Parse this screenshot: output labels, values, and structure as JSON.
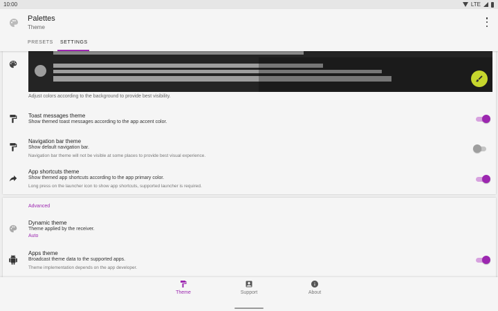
{
  "status_bar": {
    "time": "10:00",
    "network": "LTE"
  },
  "app_bar": {
    "title": "Palettes",
    "subtitle": "Theme",
    "tabs": [
      {
        "label": "PRESETS"
      },
      {
        "label": "SETTINGS"
      }
    ],
    "active_tab": "SETTINGS"
  },
  "colors": {
    "accent": "#9c27b0",
    "fab": "#c6d62d",
    "preview_bg": "#242424"
  },
  "preview": {
    "description": "Adjust colors according to the background to provide best visibility."
  },
  "settings": [
    {
      "title": "Toast messages theme",
      "subtitle": "Show themed toast messages according to the app accent color.",
      "note": "",
      "enabled": true,
      "icon": "paint-roller-icon"
    },
    {
      "title": "Navigation bar theme",
      "subtitle": "Show default navigation bar.",
      "note": "Navigation bar theme will not be visible at some places to provide best visual experience.",
      "enabled": false,
      "icon": "paint-roller-icon"
    },
    {
      "title": "App shortcuts theme",
      "subtitle": "Show themed app shortcuts according to the app primary color.",
      "note": "Long press on the launcher icon to show app shortcuts, supported launcher is required.",
      "enabled": true,
      "icon": "share-arrow-icon"
    }
  ],
  "advanced": {
    "header": "Advanced",
    "dynamic": {
      "title": "Dynamic theme",
      "subtitle": "Theme applied by the receiver.",
      "value": "Auto",
      "icon": "palette-icon"
    },
    "apps": {
      "title": "Apps theme",
      "subtitle": "Broadcast theme data to the supported apps.",
      "note": "Theme implementation depends on the app developer.",
      "enabled": true,
      "icon": "android-icon"
    }
  },
  "bottom_nav": [
    {
      "label": "Theme",
      "icon": "paint-roller-icon",
      "active": true
    },
    {
      "label": "Support",
      "icon": "contact-icon",
      "active": false
    },
    {
      "label": "About",
      "icon": "info-icon",
      "active": false
    }
  ]
}
